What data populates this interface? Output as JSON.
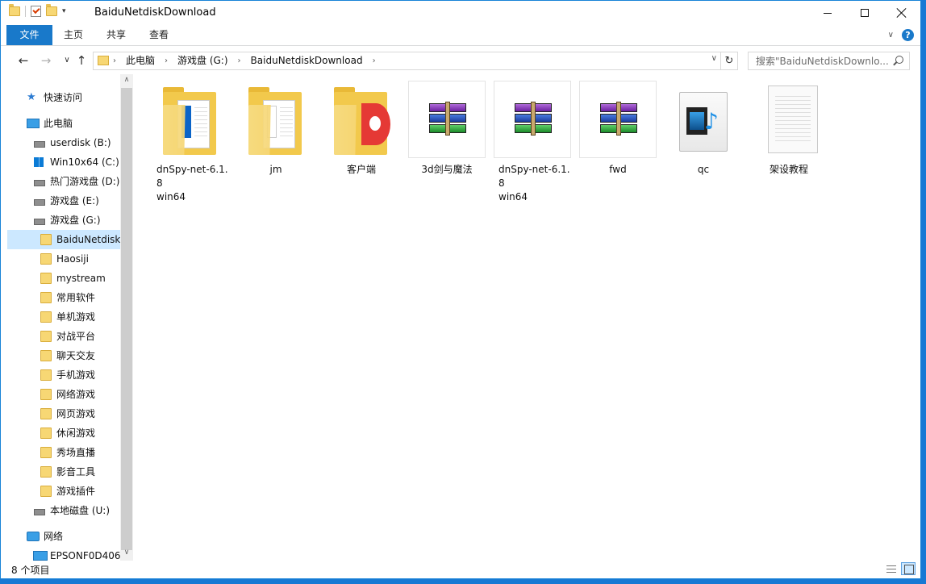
{
  "window": {
    "title": "BaiduNetdiskDownload"
  },
  "ribbon": {
    "tabs": [
      {
        "label": "文件"
      },
      {
        "label": "主页"
      },
      {
        "label": "共享"
      },
      {
        "label": "查看"
      }
    ],
    "help_label": "?"
  },
  "address": {
    "crumbs": [
      "此电脑",
      "游戏盘 (G:)",
      "BaiduNetdiskDownload"
    ]
  },
  "search": {
    "placeholder": "搜索\"BaiduNetdiskDownlo..."
  },
  "nav": {
    "items": [
      {
        "label": "快速访问",
        "icon": "star-icon"
      },
      {
        "label": "此电脑",
        "icon": "computer-icon"
      },
      {
        "label": "userdisk (B:)",
        "icon": "drive-icon"
      },
      {
        "label": "Win10x64 (C:)",
        "icon": "windows-drive-icon"
      },
      {
        "label": "热门游戏盘 (D:)",
        "icon": "drive-icon"
      },
      {
        "label": "游戏盘 (E:)",
        "icon": "drive-icon"
      },
      {
        "label": "游戏盘 (G:)",
        "icon": "drive-icon"
      },
      {
        "label": "BaiduNetdisk",
        "icon": "folder-icon",
        "selected": true
      },
      {
        "label": "Haosiji",
        "icon": "folder-icon"
      },
      {
        "label": "mystream",
        "icon": "folder-icon"
      },
      {
        "label": "常用软件",
        "icon": "folder-icon"
      },
      {
        "label": "单机游戏",
        "icon": "folder-icon"
      },
      {
        "label": "对战平台",
        "icon": "folder-icon"
      },
      {
        "label": "聊天交友",
        "icon": "folder-icon"
      },
      {
        "label": "手机游戏",
        "icon": "folder-icon"
      },
      {
        "label": "网络游戏",
        "icon": "folder-icon"
      },
      {
        "label": "网页游戏",
        "icon": "folder-icon"
      },
      {
        "label": "休闲游戏",
        "icon": "folder-icon"
      },
      {
        "label": "秀场直播",
        "icon": "folder-icon"
      },
      {
        "label": "影音工具",
        "icon": "folder-icon"
      },
      {
        "label": "游戏插件",
        "icon": "folder-icon"
      },
      {
        "label": "本地磁盘 (U:)",
        "icon": "drive-icon"
      },
      {
        "label": "网络",
        "icon": "network-icon"
      },
      {
        "label": "EPSONF0D406",
        "icon": "monitor-icon"
      }
    ]
  },
  "files": [
    {
      "name": "dnSpy-net-6.1.8 win64",
      "line1": "dnSpy-net-6.1.8",
      "line2": "win64",
      "type": "folder"
    },
    {
      "name": "jm",
      "line1": "jm",
      "line2": "",
      "type": "folder"
    },
    {
      "name": "客户端",
      "line1": "客户端",
      "line2": "",
      "type": "folder-red"
    },
    {
      "name": "3d剑与魔法",
      "line1": "3d剑与魔法",
      "line2": "",
      "type": "winrar"
    },
    {
      "name": "dnSpy-net-6.1.8 win64",
      "line1": "dnSpy-net-6.1.8",
      "line2": "win64",
      "type": "winrar"
    },
    {
      "name": "fwd",
      "line1": "fwd",
      "line2": "",
      "type": "winrar"
    },
    {
      "name": "qc",
      "line1": "qc",
      "line2": "",
      "type": "media"
    },
    {
      "name": "架设教程",
      "line1": "架设教程",
      "line2": "",
      "type": "document"
    }
  ],
  "status": {
    "item_count": "8 个项目"
  }
}
